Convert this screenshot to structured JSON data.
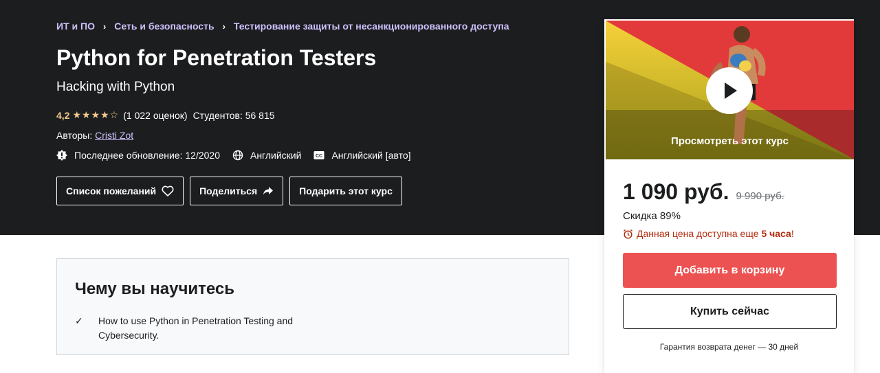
{
  "breadcrumb": [
    "ИТ и ПО",
    "Сеть и безопасность",
    "Тестирование защиты от несанкционированного доступа"
  ],
  "course": {
    "title": "Python for Penetration Testers",
    "subtitle": "Hacking with Python",
    "rating": "4,2",
    "stars_filled": 4,
    "rating_count": "(1 022 оценок)",
    "students": "Студентов: 56 815",
    "authors_label": "Авторы:",
    "author": "Cristi Zot",
    "last_updated": "Последнее обновление: 12/2020",
    "language": "Английский",
    "captions": "Английский [авто]"
  },
  "actions": {
    "wishlist": "Список пожеланий",
    "share": "Поделиться",
    "gift": "Подарить этот курс"
  },
  "sidebar": {
    "preview_label": "Просмотреть этот курс",
    "price": "1 090 руб.",
    "old_price": "9 990 руб.",
    "discount": "Скидка 89%",
    "timer_text": "Данная цена доступна еще",
    "timer_hours": "5 часа",
    "timer_suffix": "!",
    "add_to_cart": "Добавить в корзину",
    "buy_now": "Купить сейчас",
    "guarantee": "Гарантия возврата денег — 30 дней"
  },
  "learn": {
    "heading": "Чему вы научитесь",
    "items": [
      "How to use Python in Penetration Testing and Cybersecurity."
    ]
  },
  "colors": {
    "hero_bg": "#1c1d1f",
    "accent_link": "#cec0fc",
    "rating_gold": "#f3ca8c",
    "cart_red": "#ec5252",
    "timer_red": "#b32d0f"
  }
}
